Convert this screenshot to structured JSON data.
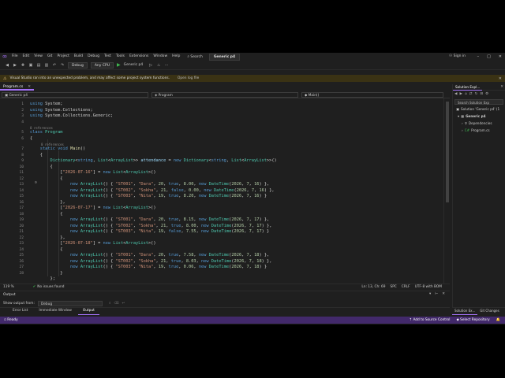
{
  "menubar": {
    "items": [
      "File",
      "Edit",
      "View",
      "Git",
      "Project",
      "Build",
      "Debug",
      "Test",
      "Tools",
      "Extensions",
      "Window",
      "Help"
    ],
    "search_label": "Search",
    "solution_name": "Generic p4",
    "sign_in": "Sign in"
  },
  "toolbar": {
    "config": "Debug",
    "platform": "Any CPU",
    "run_label": "Generic p4"
  },
  "infobar": {
    "message": "Visual Studio ran into an unexpected problem, and may affect some project system functions.",
    "link": "Open log file"
  },
  "doc_tab": {
    "label": "Program.cs"
  },
  "navbar": {
    "project": "Generic p4",
    "class": "Program",
    "member": "Main()"
  },
  "code": {
    "line_numbers": [
      "1",
      "2",
      "3",
      "4",
      "5",
      "6",
      "7",
      "8",
      "9",
      "10",
      "11",
      "12",
      "13",
      "14",
      "15",
      "16",
      "17",
      "18",
      "19",
      "20",
      "21",
      "22",
      "23",
      "24",
      "25",
      "26",
      "27",
      "28"
    ],
    "codelens_0": "0 references",
    "codelens_1": "0 references"
  },
  "editor_status": {
    "zoom": "119 %",
    "issues": "No issues found",
    "position": "Ln: 13, Ch: 69",
    "spc": "SPC",
    "eol": "CRLF",
    "encoding": "UTF-8 with BOM"
  },
  "output": {
    "title": "Output",
    "show_from_label": "Show output from:",
    "source": "Debug"
  },
  "bottom_tabs": [
    "Error List",
    "Immediate Window",
    "Output"
  ],
  "solution_explorer": {
    "tab": "Solution Expl...",
    "search_placeholder": "Search Solution Exp",
    "solution": "Solution 'Generic p4' (1",
    "project": "Generic p4",
    "dependencies": "Dependencies",
    "file": "Program.cs",
    "bottom_tabs": [
      "Solution Ex...",
      "Git Changes"
    ]
  },
  "statusbar": {
    "ready": "Ready",
    "add_source": "Add to Source Control",
    "repo": "Select Repository"
  }
}
